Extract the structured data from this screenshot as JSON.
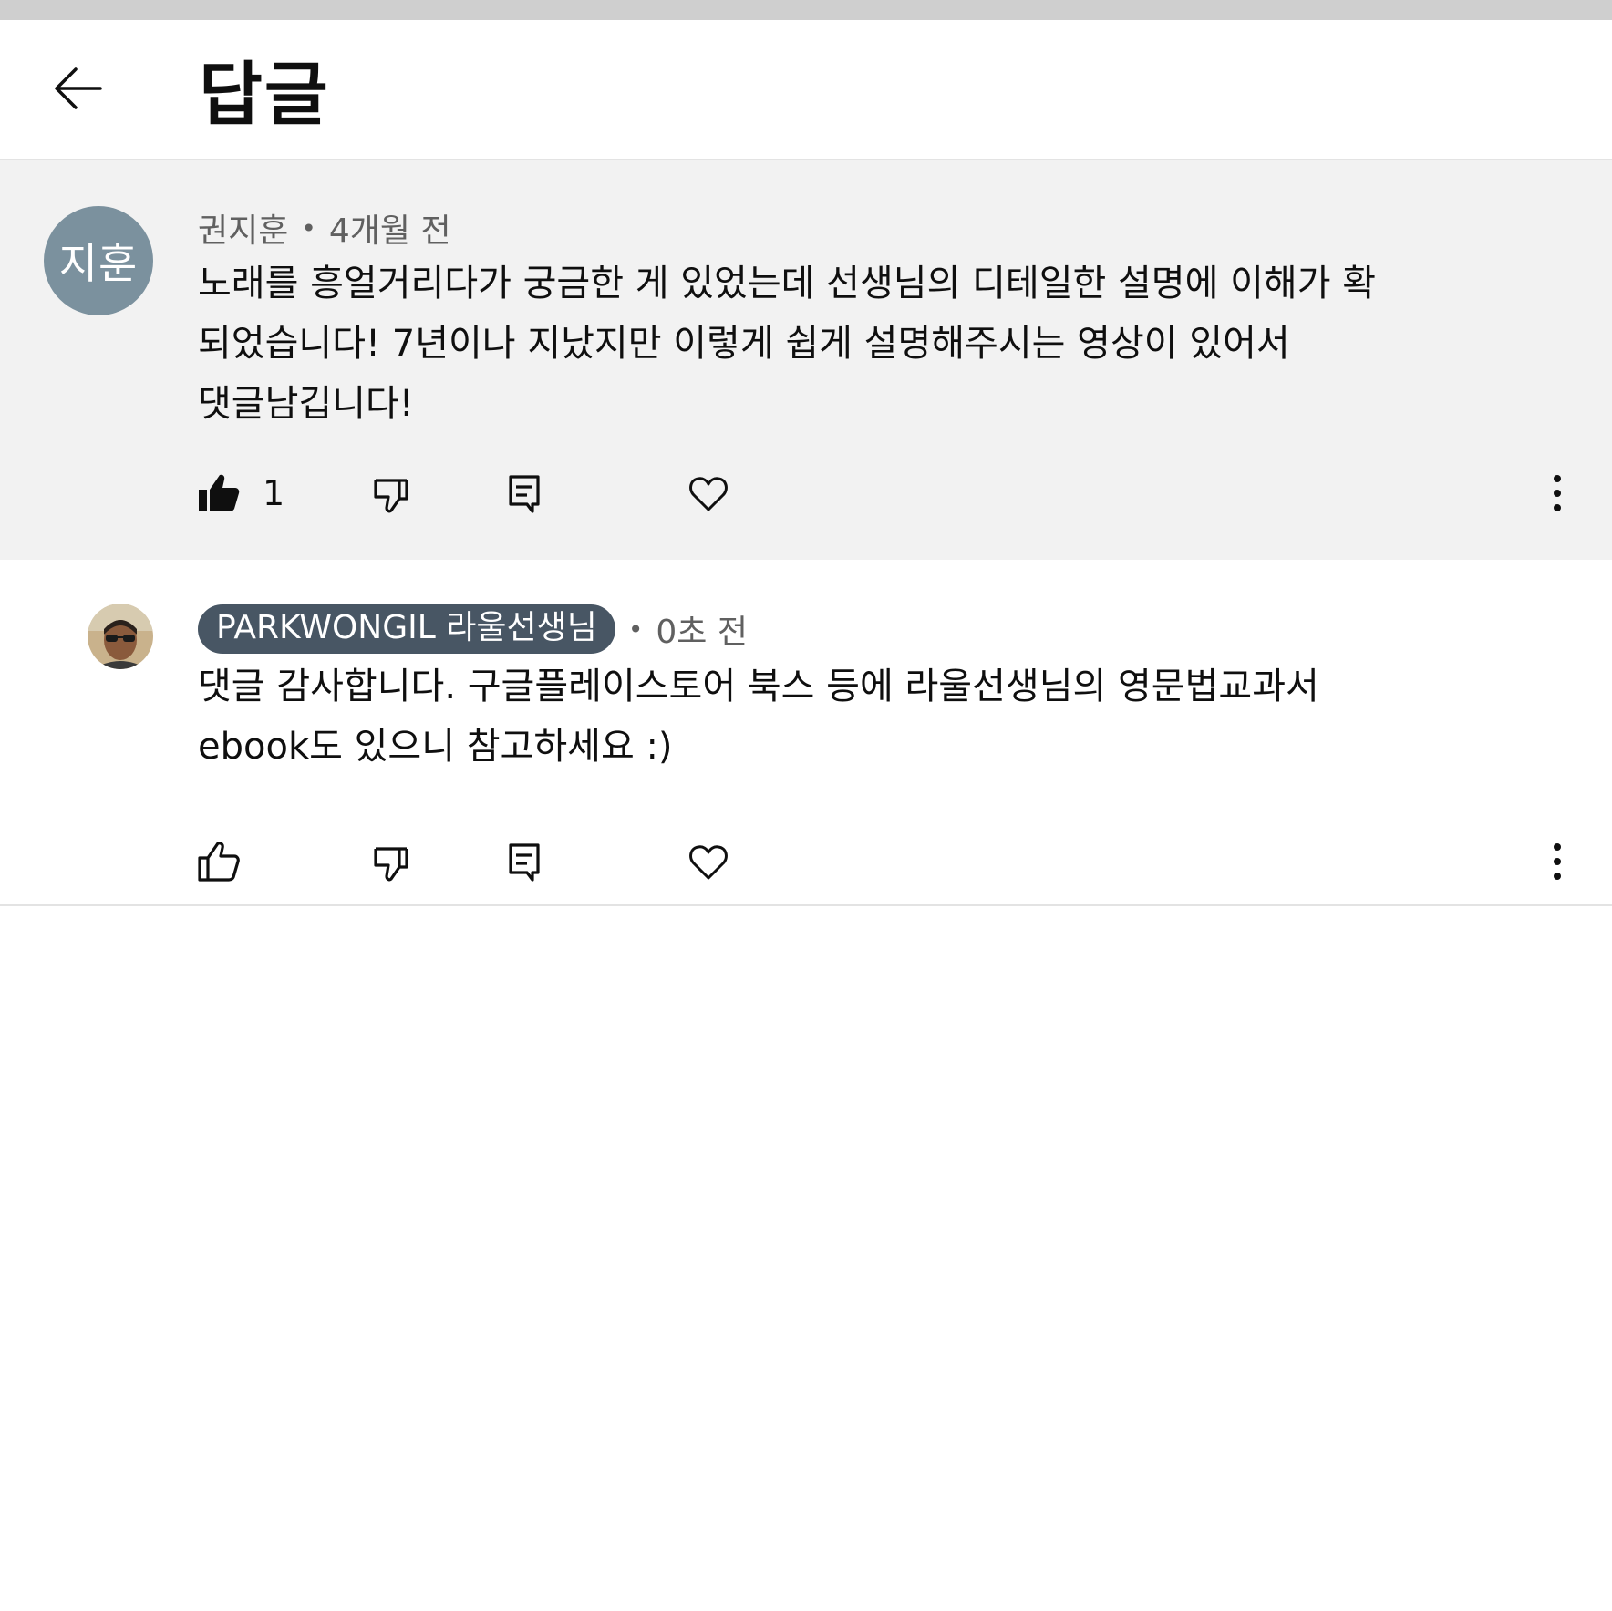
{
  "header": {
    "title": "답글"
  },
  "parent_comment": {
    "avatar_initials": "지훈",
    "author": "권지훈",
    "time": "4개월 전",
    "text": "노래를 흥얼거리다가 궁금한 게 있었는데 선생님의 디테일한 설명에 이해가 확\n되었습니다! 7년이나 지났지만 이렇게 쉽게 설명해주시는 영상이 있어서\n댓글남깁니다!",
    "like_count": "1"
  },
  "reply": {
    "author": "PARKWONGIL 라울선생님",
    "time": "0초 전",
    "text": "댓글 감사합니다. 구글플레이스토어 북스 등에 라울선생님의 영문법교과서\nebook도 있으니 참고하세요 :)"
  },
  "separator": "•",
  "colors": {
    "header_bg": "#ffffff",
    "highlight_bg": "#f2f2f2",
    "avatar_bg": "#7b919e",
    "author_badge_bg": "#485664",
    "meta_text": "#606060"
  },
  "icons": [
    "back-arrow-icon",
    "thumbs-up-filled-icon",
    "thumbs-up-outline-icon",
    "thumbs-down-icon",
    "reply-icon",
    "heart-icon",
    "more-vertical-icon"
  ]
}
